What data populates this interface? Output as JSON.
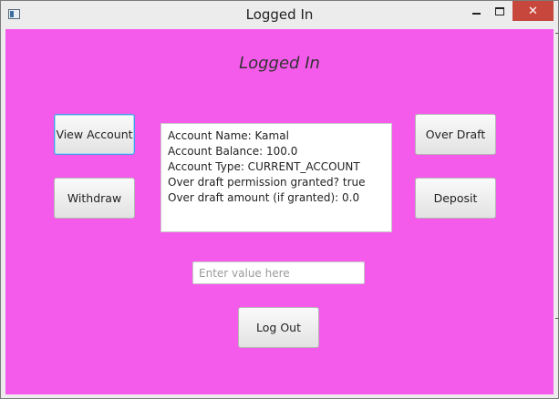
{
  "window": {
    "title": "Logged In",
    "controls": {
      "minimize": "minimize",
      "maximize": "maximize",
      "close": "✕"
    }
  },
  "main": {
    "heading": "Logged In",
    "buttons": {
      "view_account": "View Account",
      "withdraw": "Withdraw",
      "over_draft": "Over Draft",
      "deposit": "Deposit",
      "log_out": "Log Out"
    },
    "account_info": [
      "Account Name: Kamal",
      "Account Balance: 100.0",
      "Account Type: CURRENT_ACCOUNT",
      "Over draft permission granted? true",
      "Over draft amount (if granted): 0.0"
    ],
    "value_input": {
      "value": "",
      "placeholder": "Enter value here"
    }
  },
  "colors": {
    "background": "#f55beb",
    "close_button": "#c7473c",
    "focus": "#3f9fe6"
  }
}
